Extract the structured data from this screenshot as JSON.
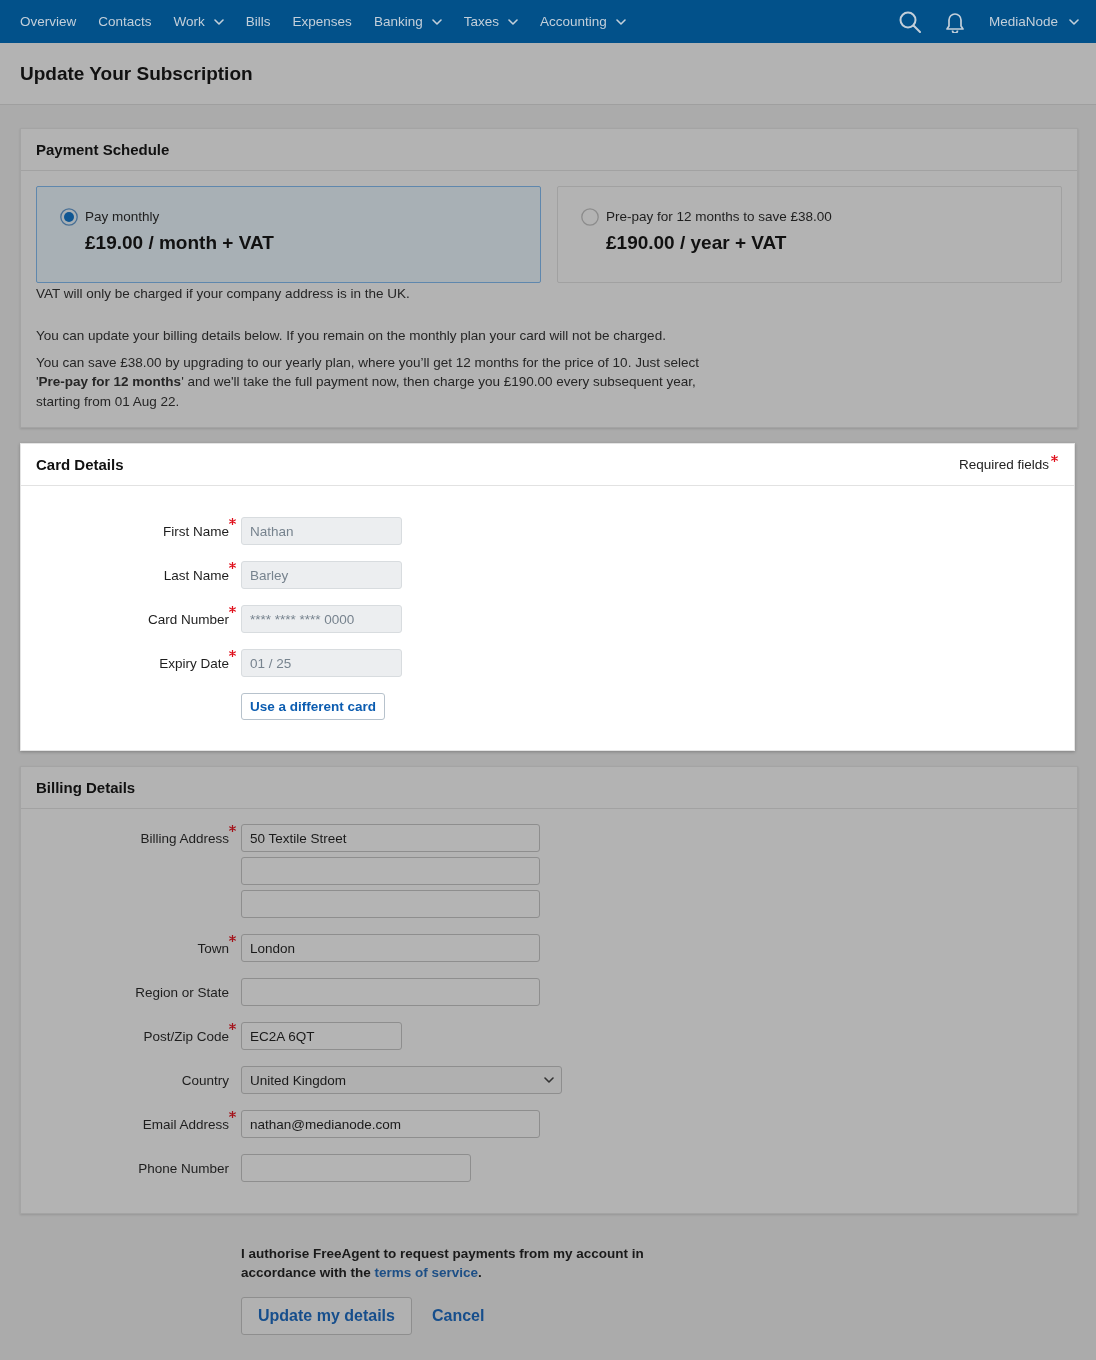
{
  "nav": {
    "items": [
      {
        "label": "Overview",
        "dropdown": false
      },
      {
        "label": "Contacts",
        "dropdown": false
      },
      {
        "label": "Work",
        "dropdown": true
      },
      {
        "label": "Bills",
        "dropdown": false
      },
      {
        "label": "Expenses",
        "dropdown": false
      },
      {
        "label": "Banking",
        "dropdown": true
      },
      {
        "label": "Taxes",
        "dropdown": true
      },
      {
        "label": "Accounting",
        "dropdown": true
      }
    ],
    "account": {
      "label": "MediaNode",
      "dropdown": true
    }
  },
  "page": {
    "title": "Update Your Subscription"
  },
  "payment_schedule": {
    "title": "Payment Schedule",
    "highlighted": false,
    "options": [
      {
        "label": "Pay monthly",
        "price": "£19.00 / month + VAT",
        "selected": true
      },
      {
        "label": "Pre-pay for 12 months to save £38.00",
        "price": "£190.00 / year + VAT",
        "selected": false
      }
    ],
    "vat_note": "VAT will only be charged if your company address is in the UK.",
    "paragraphs": [
      "You can update your billing details below. If you remain on the monthly plan your card will not be charged.",
      "You can save £38.00 by upgrading to our yearly plan, where you’ll get 12 months for the price of 10. Just select '**Pre-pay for 12 months**' and we'll take the full payment now, then charge you £190.00 every subsequent year, starting from 01 Aug 22."
    ]
  },
  "card_details": {
    "title": "Card Details",
    "highlighted": true,
    "required_note": "Required fields",
    "fields": [
      {
        "kind": "text",
        "label": "First Name",
        "required": true,
        "disabled": true,
        "value": "Nathan"
      },
      {
        "kind": "text",
        "label": "Last Name",
        "required": true,
        "disabled": true,
        "value": "Barley"
      },
      {
        "kind": "text",
        "label": "Card Number",
        "required": true,
        "disabled": true,
        "value": "**** **** **** 0000"
      },
      {
        "kind": "text",
        "label": "Expiry Date",
        "required": true,
        "disabled": true,
        "value": "01 / 25"
      }
    ],
    "button": "Use a different card"
  },
  "billing_details": {
    "title": "Billing Details",
    "highlighted": false,
    "fields": [
      {
        "kind": "text",
        "label": "Billing Address",
        "required": true,
        "value": "50 Textile Street"
      },
      {
        "kind": "continuation",
        "required": false
      },
      {
        "kind": "continuation",
        "required": false
      },
      {
        "kind": "text",
        "label": "Town",
        "required": true,
        "value": "London"
      },
      {
        "kind": "text",
        "label": "Region or State",
        "required": false
      },
      {
        "kind": "text",
        "label": "Post/Zip Code",
        "required": true,
        "value": "EC2A 6QT"
      },
      {
        "kind": "select",
        "label": "Country",
        "required": false,
        "value": "United Kingdom"
      },
      {
        "kind": "text",
        "label": "Email Address",
        "required": true,
        "value": "nathan@medianode.com"
      },
      {
        "kind": "text",
        "label": "Phone Number",
        "required": false
      }
    ]
  },
  "footer": {
    "authorisation": {
      "text": "I authorise FreeAgent to request payments from my account in accordance with the ",
      "link": "terms of service",
      "end": "."
    },
    "buttons": [
      {
        "kind": "primary",
        "label": "Update my details"
      },
      {
        "kind": "link",
        "label": "Cancel"
      }
    ]
  }
}
